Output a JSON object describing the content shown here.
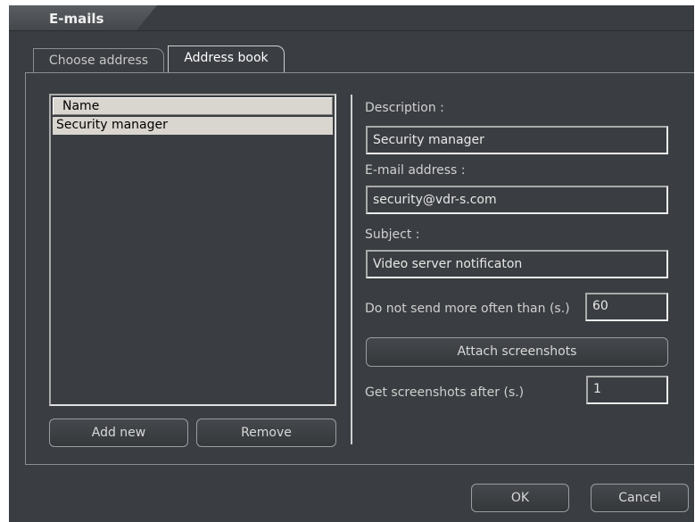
{
  "window": {
    "title": "E-mails"
  },
  "tabs": [
    {
      "label": "Choose address",
      "active": false
    },
    {
      "label": "Address book",
      "active": true
    }
  ],
  "list": {
    "header": "Name",
    "rows": [
      "Security manager"
    ]
  },
  "buttons": {
    "add_new": "Add new",
    "remove": "Remove",
    "attach_screenshots": "Attach screenshots",
    "ok": "OK",
    "cancel": "Cancel"
  },
  "form": {
    "description_label": "Description :",
    "description_value": "Security manager",
    "email_label": "E-mail address :",
    "email_value": "security@vdr-s.com",
    "subject_label": "Subject :",
    "subject_value": "Video server notificaton",
    "frequency_label": "Do not send more often than (s.)",
    "frequency_value": "60",
    "delay_label": "Get screenshots after (s.)",
    "delay_value": "1"
  },
  "colors": {
    "background": "#3a3d41",
    "list_header": "#d9d5cf",
    "border_light": "#e0e0e0"
  }
}
